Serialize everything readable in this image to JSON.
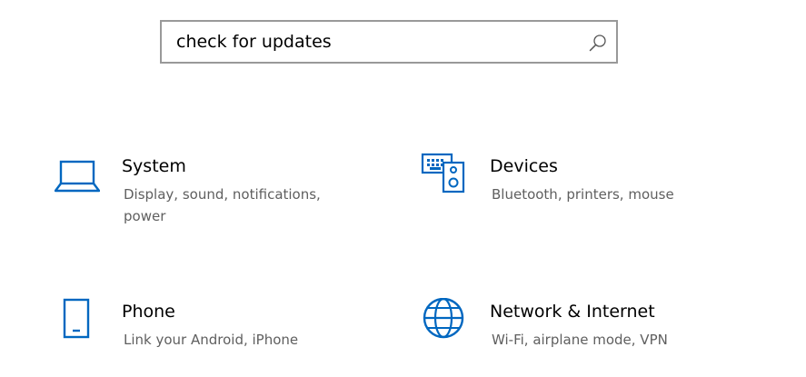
{
  "search": {
    "value": "check for updates",
    "icon": "search-icon"
  },
  "accent_color": "#0067c0",
  "tiles": [
    {
      "title": "System",
      "description": "Display, sound, notifications, power",
      "icon": "laptop-icon"
    },
    {
      "title": "Devices",
      "description": "Bluetooth, printers, mouse",
      "icon": "devices-icon"
    },
    {
      "title": "Phone",
      "description": "Link your Android, iPhone",
      "icon": "phone-icon"
    },
    {
      "title": "Network & Internet",
      "description": "Wi-Fi, airplane mode, VPN",
      "icon": "globe-icon"
    }
  ]
}
